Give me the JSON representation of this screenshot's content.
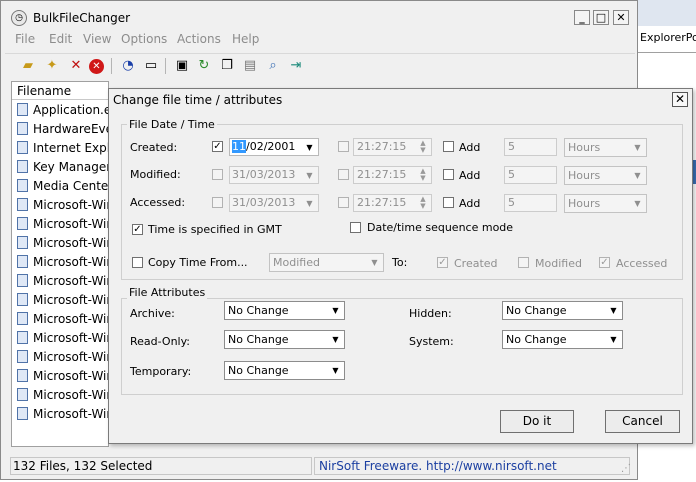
{
  "background_window": {
    "tab_text": "ExplorerPo"
  },
  "app": {
    "title": "BulkFileChanger"
  },
  "window_buttons": {
    "minimize": "_",
    "maximize": "□",
    "close": "✕"
  },
  "menu": [
    "File",
    "Edit",
    "View",
    "Options",
    "Actions",
    "Help"
  ],
  "toolbar": [
    "open-folder-icon",
    "add-files-icon",
    "delete-icon",
    "remove-all-icon",
    "clock-icon",
    "window-icon",
    "save-icon",
    "refresh-icon",
    "copy-icon",
    "properties-icon",
    "find-icon",
    "exit-icon"
  ],
  "list": {
    "column": "Filename",
    "rows": [
      "Application.ev",
      "HardwareEven",
      "Internet Explor",
      "Key Managem",
      "Media Center.",
      "Microsoft-Win",
      "Microsoft-Win",
      "Microsoft-Win",
      "Microsoft-Win",
      "Microsoft-Win",
      "Microsoft-Win",
      "Microsoft-Win",
      "Microsoft-Win",
      "Microsoft-Win",
      "Microsoft-Win",
      "Microsoft-Win",
      "Microsoft-Win"
    ]
  },
  "status": {
    "selection": "132 Files, 132 Selected",
    "credit": "NirSoft Freeware.  http://www.nirsoft.net"
  },
  "dialog": {
    "title": "Change file time / attributes",
    "close": "✕",
    "date_group": "File Date / Time",
    "rows": [
      {
        "label": "Created:",
        "checked": true,
        "date_sel": "11",
        "date_rest": "/02/2001",
        "time": "21:27:15",
        "add": "Add",
        "amount": "5",
        "unit": "Hours"
      },
      {
        "label": "Modified:",
        "checked": false,
        "date_sel": "",
        "date_rest": "31/03/2013",
        "time": "21:27:15",
        "add": "Add",
        "amount": "5",
        "unit": "Hours"
      },
      {
        "label": "Accessed:",
        "checked": false,
        "date_sel": "",
        "date_rest": "31/03/2013",
        "time": "21:27:15",
        "add": "Add",
        "amount": "5",
        "unit": "Hours"
      }
    ],
    "gmt": {
      "label": "Time is specified in GMT",
      "checked": true
    },
    "sequence": {
      "label": "Date/time sequence mode",
      "checked": false
    },
    "copy_time": {
      "label": "Copy Time From...",
      "source": "Modified",
      "to": "To:",
      "targets": [
        "Created",
        "Modified",
        "Accessed"
      ]
    },
    "attr_group": "File Attributes",
    "attributes": [
      {
        "label": "Archive:",
        "value": "No Change"
      },
      {
        "label": "Read-Only:",
        "value": "No Change"
      },
      {
        "label": "Temporary:",
        "value": "No Change"
      },
      {
        "label": "Hidden:",
        "value": "No Change"
      },
      {
        "label": "System:",
        "value": "No Change"
      }
    ],
    "do_it": "Do it",
    "cancel": "Cancel"
  }
}
